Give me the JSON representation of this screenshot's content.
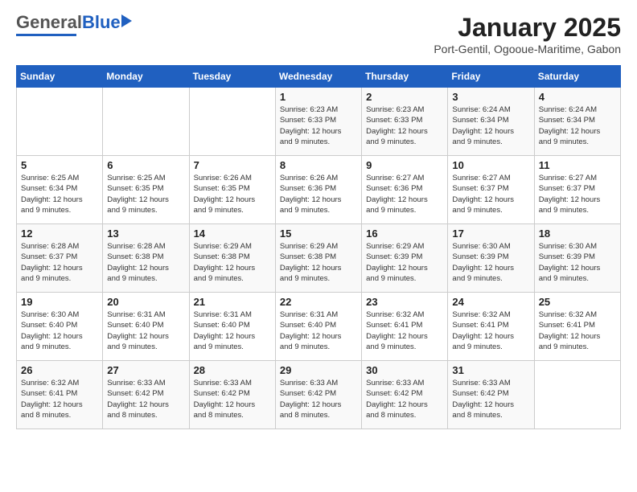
{
  "header": {
    "logo_general": "General",
    "logo_blue": "Blue",
    "title": "January 2025",
    "subtitle": "Port-Gentil, Ogooue-Maritime, Gabon"
  },
  "days_of_week": [
    "Sunday",
    "Monday",
    "Tuesday",
    "Wednesday",
    "Thursday",
    "Friday",
    "Saturday"
  ],
  "weeks": [
    [
      {
        "day": "",
        "info": ""
      },
      {
        "day": "",
        "info": ""
      },
      {
        "day": "",
        "info": ""
      },
      {
        "day": "1",
        "info": "Sunrise: 6:23 AM\nSunset: 6:33 PM\nDaylight: 12 hours\nand 9 minutes."
      },
      {
        "day": "2",
        "info": "Sunrise: 6:23 AM\nSunset: 6:33 PM\nDaylight: 12 hours\nand 9 minutes."
      },
      {
        "day": "3",
        "info": "Sunrise: 6:24 AM\nSunset: 6:34 PM\nDaylight: 12 hours\nand 9 minutes."
      },
      {
        "day": "4",
        "info": "Sunrise: 6:24 AM\nSunset: 6:34 PM\nDaylight: 12 hours\nand 9 minutes."
      }
    ],
    [
      {
        "day": "5",
        "info": "Sunrise: 6:25 AM\nSunset: 6:34 PM\nDaylight: 12 hours\nand 9 minutes."
      },
      {
        "day": "6",
        "info": "Sunrise: 6:25 AM\nSunset: 6:35 PM\nDaylight: 12 hours\nand 9 minutes."
      },
      {
        "day": "7",
        "info": "Sunrise: 6:26 AM\nSunset: 6:35 PM\nDaylight: 12 hours\nand 9 minutes."
      },
      {
        "day": "8",
        "info": "Sunrise: 6:26 AM\nSunset: 6:36 PM\nDaylight: 12 hours\nand 9 minutes."
      },
      {
        "day": "9",
        "info": "Sunrise: 6:27 AM\nSunset: 6:36 PM\nDaylight: 12 hours\nand 9 minutes."
      },
      {
        "day": "10",
        "info": "Sunrise: 6:27 AM\nSunset: 6:37 PM\nDaylight: 12 hours\nand 9 minutes."
      },
      {
        "day": "11",
        "info": "Sunrise: 6:27 AM\nSunset: 6:37 PM\nDaylight: 12 hours\nand 9 minutes."
      }
    ],
    [
      {
        "day": "12",
        "info": "Sunrise: 6:28 AM\nSunset: 6:37 PM\nDaylight: 12 hours\nand 9 minutes."
      },
      {
        "day": "13",
        "info": "Sunrise: 6:28 AM\nSunset: 6:38 PM\nDaylight: 12 hours\nand 9 minutes."
      },
      {
        "day": "14",
        "info": "Sunrise: 6:29 AM\nSunset: 6:38 PM\nDaylight: 12 hours\nand 9 minutes."
      },
      {
        "day": "15",
        "info": "Sunrise: 6:29 AM\nSunset: 6:38 PM\nDaylight: 12 hours\nand 9 minutes."
      },
      {
        "day": "16",
        "info": "Sunrise: 6:29 AM\nSunset: 6:39 PM\nDaylight: 12 hours\nand 9 minutes."
      },
      {
        "day": "17",
        "info": "Sunrise: 6:30 AM\nSunset: 6:39 PM\nDaylight: 12 hours\nand 9 minutes."
      },
      {
        "day": "18",
        "info": "Sunrise: 6:30 AM\nSunset: 6:39 PM\nDaylight: 12 hours\nand 9 minutes."
      }
    ],
    [
      {
        "day": "19",
        "info": "Sunrise: 6:30 AM\nSunset: 6:40 PM\nDaylight: 12 hours\nand 9 minutes."
      },
      {
        "day": "20",
        "info": "Sunrise: 6:31 AM\nSunset: 6:40 PM\nDaylight: 12 hours\nand 9 minutes."
      },
      {
        "day": "21",
        "info": "Sunrise: 6:31 AM\nSunset: 6:40 PM\nDaylight: 12 hours\nand 9 minutes."
      },
      {
        "day": "22",
        "info": "Sunrise: 6:31 AM\nSunset: 6:40 PM\nDaylight: 12 hours\nand 9 minutes."
      },
      {
        "day": "23",
        "info": "Sunrise: 6:32 AM\nSunset: 6:41 PM\nDaylight: 12 hours\nand 9 minutes."
      },
      {
        "day": "24",
        "info": "Sunrise: 6:32 AM\nSunset: 6:41 PM\nDaylight: 12 hours\nand 9 minutes."
      },
      {
        "day": "25",
        "info": "Sunrise: 6:32 AM\nSunset: 6:41 PM\nDaylight: 12 hours\nand 9 minutes."
      }
    ],
    [
      {
        "day": "26",
        "info": "Sunrise: 6:32 AM\nSunset: 6:41 PM\nDaylight: 12 hours\nand 8 minutes."
      },
      {
        "day": "27",
        "info": "Sunrise: 6:33 AM\nSunset: 6:42 PM\nDaylight: 12 hours\nand 8 minutes."
      },
      {
        "day": "28",
        "info": "Sunrise: 6:33 AM\nSunset: 6:42 PM\nDaylight: 12 hours\nand 8 minutes."
      },
      {
        "day": "29",
        "info": "Sunrise: 6:33 AM\nSunset: 6:42 PM\nDaylight: 12 hours\nand 8 minutes."
      },
      {
        "day": "30",
        "info": "Sunrise: 6:33 AM\nSunset: 6:42 PM\nDaylight: 12 hours\nand 8 minutes."
      },
      {
        "day": "31",
        "info": "Sunrise: 6:33 AM\nSunset: 6:42 PM\nDaylight: 12 hours\nand 8 minutes."
      },
      {
        "day": "",
        "info": ""
      }
    ]
  ]
}
